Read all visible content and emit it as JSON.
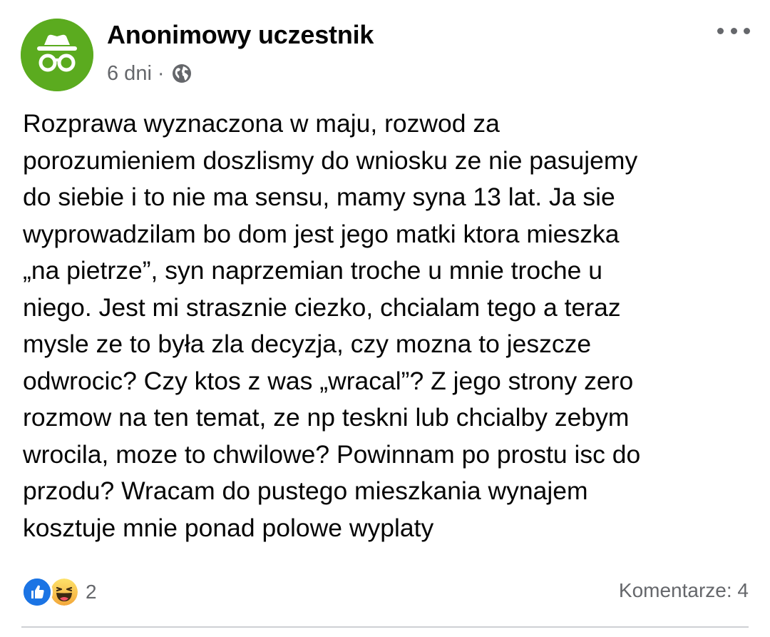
{
  "post": {
    "author": "Anonimowy uczestnik",
    "avatar_icon": "incognito-icon",
    "avatar_color": "#5bab1f",
    "time": "6 dni",
    "separator": "·",
    "audience_icon": "globe-icon",
    "more_icon": "more-options-icon",
    "text": "Rozprawa wyznaczona w maju, rozwod za\nporozumieniem doszlismy do wniosku ze nie pasujemy\ndo siebie i to nie ma sensu, mamy syna 13 lat. Ja sie\nwyprowadzilam bo dom jest jego matki ktora mieszka\n„na pietrze”, syn naprzemian troche u mnie troche u\nniego. Jest mi strasznie ciezko, chcialam tego a teraz\nmysle ze to była zla decyzja, czy mozna to jeszcze\nodwrocic? Czy ktos z was „wracal”? Z jego strony zero\nrozmow na ten temat, ze np teskni lub chcialby zebym\nwrocila, moze to chwilowe? Powinnam po prostu isc do\nprzodu? Wracam do pustego mieszkania wynajem\nkosztuje mnie ponad polowe wyplaty",
    "reactions": {
      "icons": [
        "like-icon",
        "haha-icon"
      ],
      "count": "2"
    },
    "comments_label": "Komentarze: 4"
  },
  "colors": {
    "text_primary": "#050505",
    "text_secondary": "#65676b",
    "like_blue": "#1b74e4",
    "haha_yellow": "#f7c940",
    "divider": "#ced0d4"
  }
}
